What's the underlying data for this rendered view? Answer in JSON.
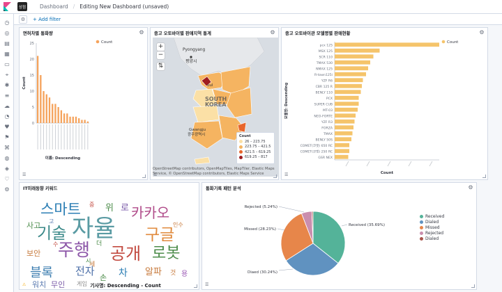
{
  "header": {
    "space_badge": "상점",
    "breadcrumb_root": "Dashboard",
    "breadcrumb_current": "Editing New Dashboard (unsaved)"
  },
  "filter_bar": {
    "add_filter": "+ Add filter"
  },
  "nav_icons": [
    "clock-icon",
    "compass-icon",
    "chart-icon",
    "dashboard-icon",
    "briefcase-icon",
    "map-pin-icon",
    "bug-icon",
    "stack-icon",
    "cloud-icon",
    "apm-icon",
    "uptime-icon",
    "siem-icon",
    "dev-tools-icon",
    "monitoring-icon",
    "security-icon",
    "heart-icon",
    "gear-icon"
  ],
  "panels": {
    "p1": {
      "title": "면허차별 통화량",
      "chart_data": {
        "type": "bar",
        "legend": "Count",
        "ylabel": "Count",
        "xlabel": "이름: Descending",
        "ylim": [
          0,
          25
        ],
        "yticks": [
          0,
          5,
          10,
          15,
          20,
          25
        ],
        "values": [
          21,
          15,
          10,
          9,
          8,
          6,
          6,
          5,
          4,
          3,
          3,
          2,
          2,
          2,
          1.5,
          1,
          1,
          0.5
        ],
        "categories": [
          "",
          "",
          "",
          "",
          "",
          "",
          "",
          "",
          "",
          "",
          "",
          "",
          "",
          "",
          "",
          "",
          "",
          ""
        ]
      }
    },
    "p2": {
      "title": "중고 오토바이별 판매지역 통계",
      "map_labels": {
        "pyongyang_en": "Pyongyang",
        "pyongyang_ko": "평양시",
        "seoul": "oul",
        "south_korea_1": "SOUTH",
        "south_korea_2": "KOREA",
        "gwangju_en": "Gwangju",
        "gwangju_ko": "광주광역시"
      },
      "legend": {
        "title": "Count",
        "items": [
          {
            "label": "26 – 223.75",
            "color": "#fbe0a6"
          },
          {
            "label": "223.75 – 421.5",
            "color": "#f5b461"
          },
          {
            "label": "421.5 – 619.25",
            "color": "#e8662c"
          },
          {
            "label": "619.25 – 817",
            "color": "#9f1d20"
          }
        ]
      },
      "attribution": "OpenStreetMap contributors, OpenMapTiles, MapTiler, Elastic Maps Service, © OpenStreetMap contributors, Elastic Maps Service"
    },
    "p3": {
      "title": "중고 오토바이관 모델명별 판매현황",
      "chart_data": {
        "type": "bar",
        "orientation": "horizontal",
        "legend": "Count",
        "ylabel": "모델명: Descending",
        "xlabel": "Count",
        "xticks": [
          "",
          "",
          "",
          "",
          ""
        ],
        "categories": [
          "pcx 125",
          "MSX 125",
          "SCR 110",
          "TMAX 530",
          "NMAX 125",
          "R-town125i",
          "YZF R6",
          "CBR 125 R",
          "BENLY 110",
          "PCX",
          "SUPER CUB",
          "MT-03",
          "NEO-FORTE",
          "YZF R3",
          "FORZA",
          "TMAX",
          "BENLY 50S",
          "COMET(코멧) 650 RC",
          "COMET(코멧) 250 RC",
          "GSR NEX"
        ],
        "values": [
          100,
          43,
          37,
          34,
          32,
          30,
          27,
          26,
          25,
          23,
          23,
          22,
          20,
          19,
          18,
          17,
          16,
          14,
          14,
          13
        ]
      }
    },
    "p4": {
      "title": "IT미래동향 키워드",
      "footer": "기사명: Descending - Count",
      "words": [
        {
          "text": "스마트",
          "color": "#2b7eb4"
        },
        {
          "text": "자율",
          "color": "#5a9ba3"
        },
        {
          "text": "기술",
          "color": "#3c8a8a"
        },
        {
          "text": "카카오",
          "color": "#b04c8a"
        },
        {
          "text": "구글",
          "color": "#e08a3c"
        },
        {
          "text": "주행",
          "color": "#8c56a8"
        },
        {
          "text": "공개",
          "color": "#c2493f"
        },
        {
          "text": "로봇",
          "color": "#4c8c4a"
        },
        {
          "text": "블록",
          "color": "#3d7eb0"
        },
        {
          "text": "전자",
          "color": "#4c6fa8"
        },
        {
          "text": "위",
          "color": "#4c8c4a"
        },
        {
          "text": "로",
          "color": "#7a5aa8"
        },
        {
          "text": "보안",
          "color": "#c77a3c"
        },
        {
          "text": "사고",
          "color": "#4c8c4a"
        },
        {
          "text": "알파",
          "color": "#c77a3c"
        },
        {
          "text": "차",
          "color": "#2b7eb4"
        },
        {
          "text": "손",
          "color": "#4c8c4a"
        },
        {
          "text": "워치",
          "color": "#5a7ab0"
        },
        {
          "text": "무인",
          "color": "#7a5aa8"
        },
        {
          "text": "게임",
          "color": "#888888"
        },
        {
          "text": "중",
          "color": "#c2493f"
        },
        {
          "text": "것",
          "color": "#c77a3c"
        },
        {
          "text": "용",
          "color": "#9b59b6"
        },
        {
          "text": "더",
          "color": "#4c8c4a"
        },
        {
          "text": "인수",
          "color": "#c77a3c"
        },
        {
          "text": "수",
          "color": "#c2493f"
        },
        {
          "text": "고",
          "color": "#5a7ab0"
        },
        {
          "text": "세",
          "color": "#c77a3c"
        },
        {
          "text": "시",
          "color": "#4c8c4a"
        }
      ]
    },
    "p5": {
      "title": "통화기록 패턴 분석",
      "chart_data": {
        "type": "pie",
        "slices": [
          {
            "label": "Received",
            "value": 35.69,
            "color": "#54b399"
          },
          {
            "label": "Dialed",
            "value": 30.24,
            "color": "#6092c0"
          },
          {
            "label": "Missed",
            "value": 28.23,
            "color": "#e7864a"
          },
          {
            "label": "Rejected",
            "value": 5.24,
            "color": "#ca8eae"
          },
          {
            "label": "Dialed",
            "value": 0.6,
            "color": "#a9544c"
          }
        ],
        "slice_labels": [
          "Received (35.69%)",
          "Diaed (30.24%)",
          "Missed (28.23%)",
          "Rejected (5.24%)"
        ],
        "legend": [
          "Received",
          "Dialed",
          "Missed",
          "Rejected",
          "Dialed"
        ]
      }
    }
  }
}
